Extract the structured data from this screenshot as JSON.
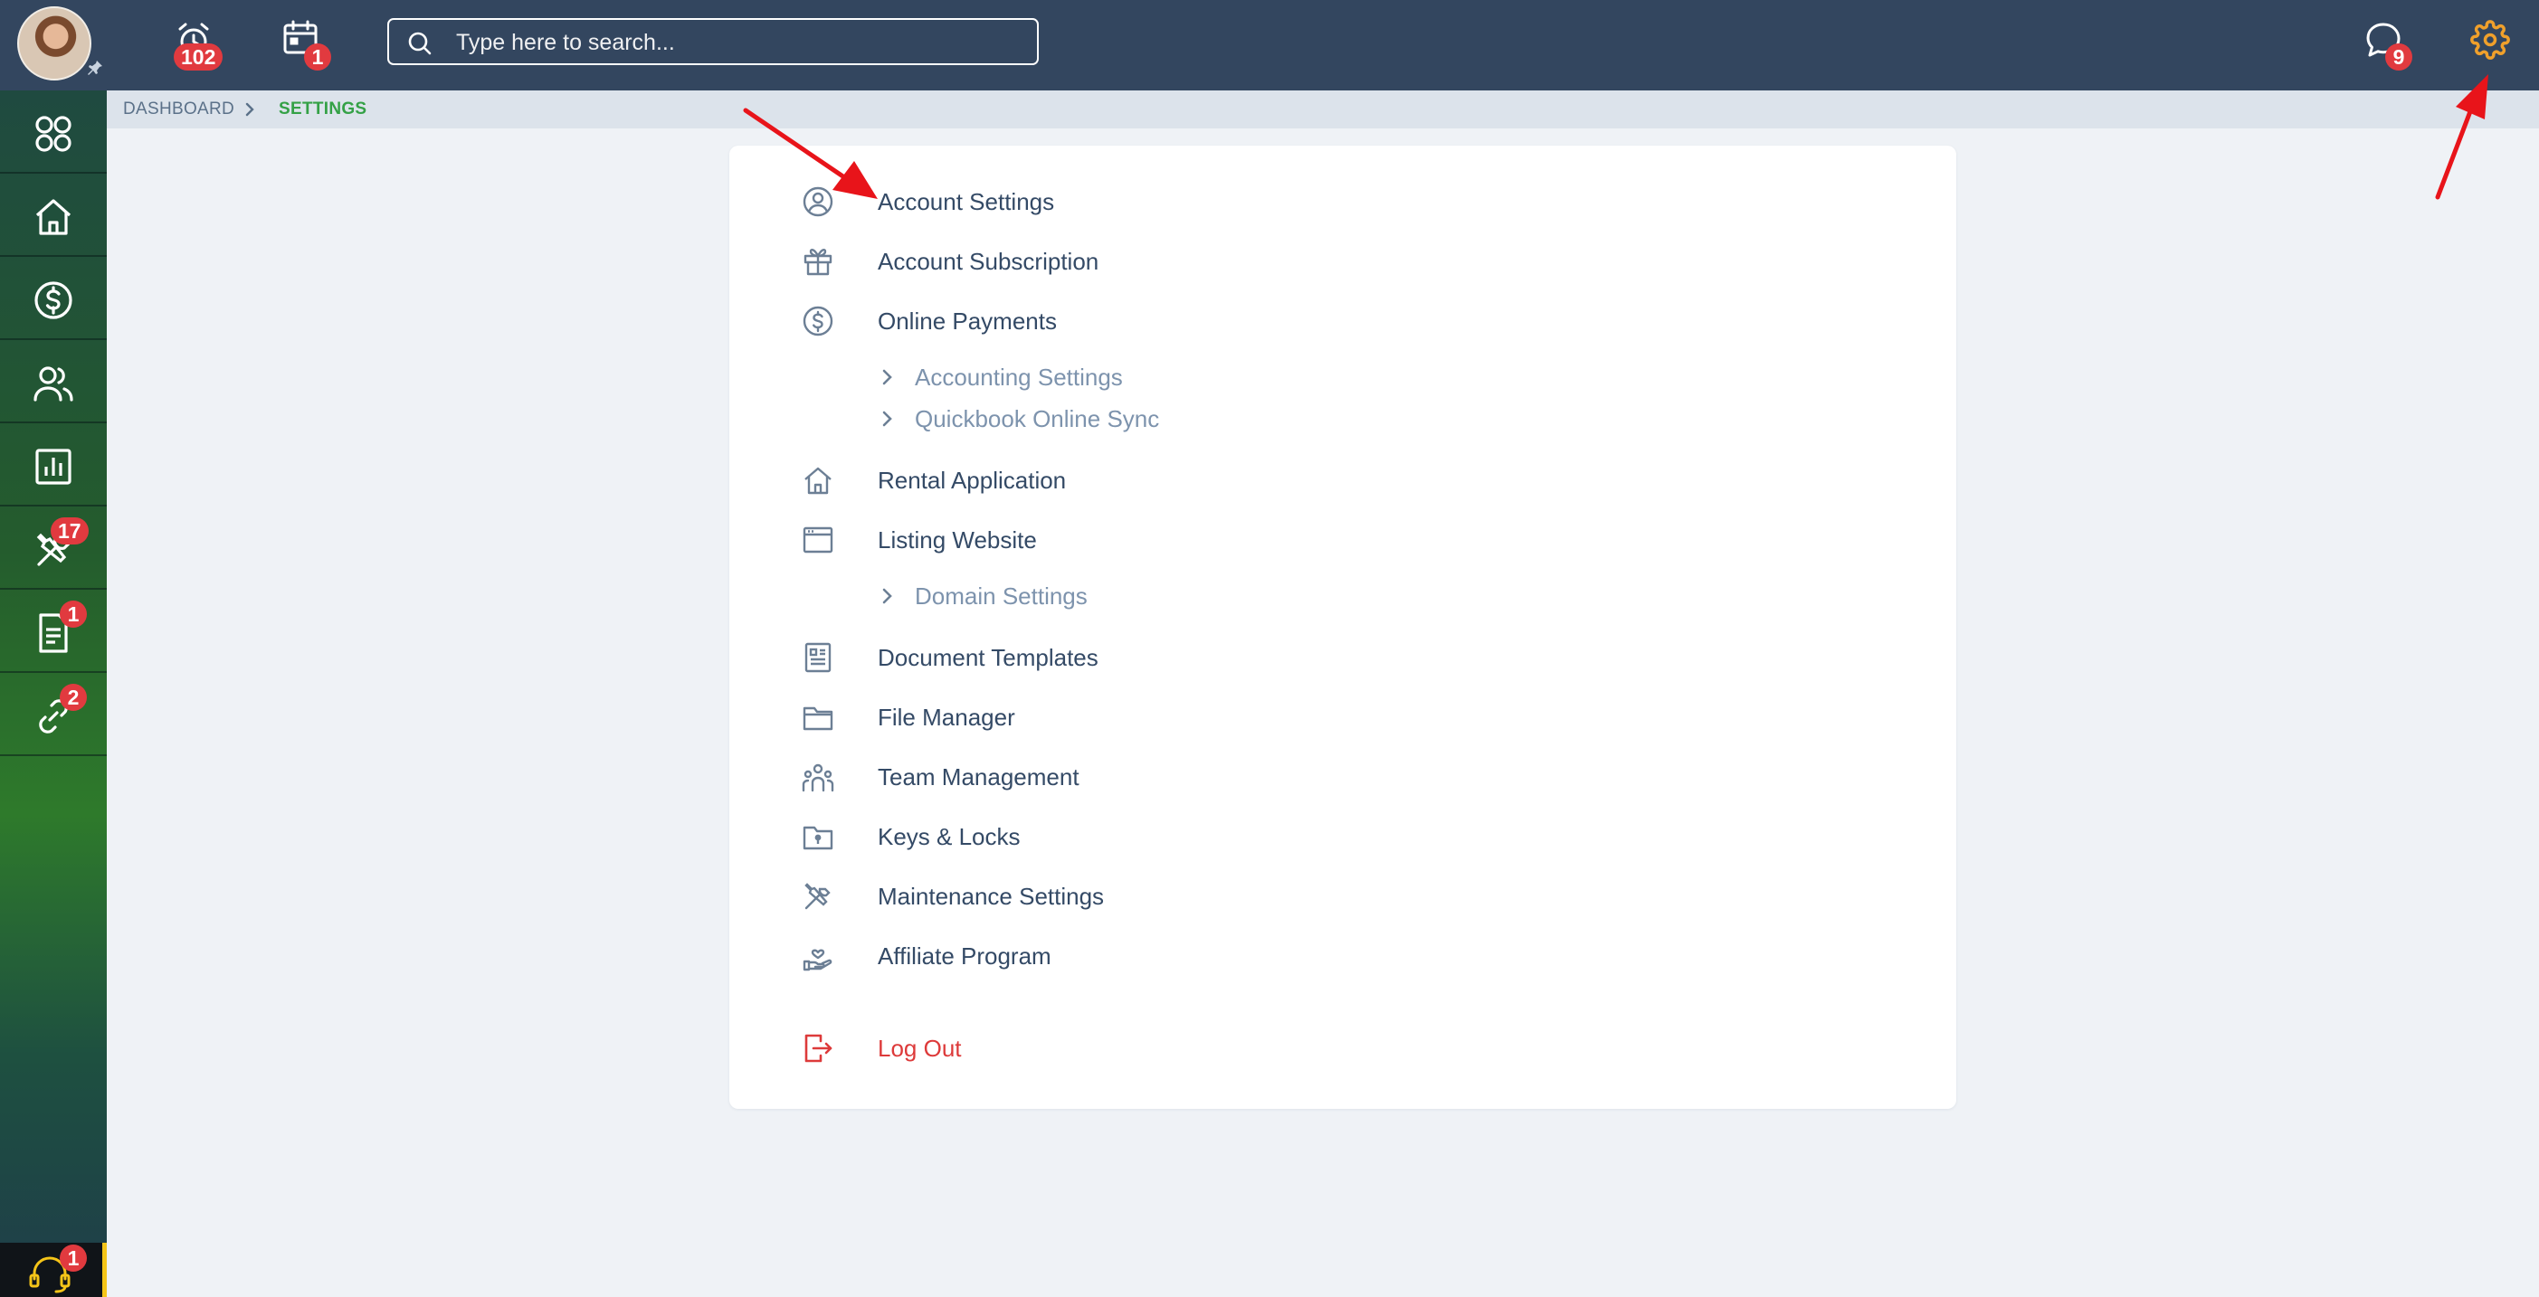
{
  "topbar": {
    "alarm_badge": "102",
    "calendar_badge": "1",
    "search_placeholder": "Type here to search...",
    "chat_badge": "9",
    "settings_color": "#f0a02b"
  },
  "sidebar": {
    "items": [
      {
        "icon": "apps-icon",
        "badge": ""
      },
      {
        "icon": "home-icon",
        "badge": ""
      },
      {
        "icon": "dollar-circle-icon",
        "badge": ""
      },
      {
        "icon": "users-icon",
        "badge": ""
      },
      {
        "icon": "chart-icon",
        "badge": ""
      },
      {
        "icon": "tools-icon",
        "badge": "17"
      },
      {
        "icon": "document-icon",
        "badge": "1"
      },
      {
        "icon": "link-icon",
        "badge": "2"
      }
    ],
    "support_badge": "1"
  },
  "breadcrumb": {
    "home": "DASHBOARD",
    "current": "SETTINGS"
  },
  "menu": {
    "account_settings": "Account Settings",
    "account_subscription": "Account Subscription",
    "online_payments": "Online Payments",
    "accounting_settings": "Accounting Settings",
    "quickbook_sync": "Quickbook Online Sync",
    "rental_application": "Rental Application",
    "listing_website": "Listing Website",
    "domain_settings": "Domain Settings",
    "document_templates": "Document Templates",
    "file_manager": "File Manager",
    "team_management": "Team Management",
    "keys_locks": "Keys & Locks",
    "maintenance_settings": "Maintenance Settings",
    "affiliate_program": "Affiliate Program",
    "log_out": "Log Out"
  },
  "colors": {
    "topbar": "#33465f",
    "accent_green": "#34a146",
    "badge_red": "#e13a3f",
    "logout_red": "#dd3a3a",
    "annotation_red": "#e8141a"
  }
}
